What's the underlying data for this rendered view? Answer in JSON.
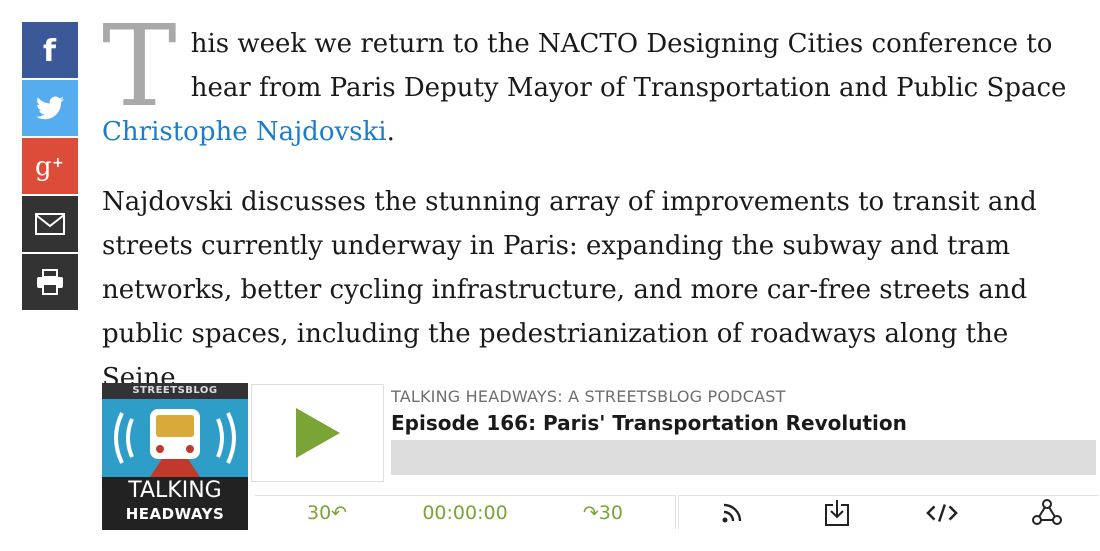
{
  "share": {
    "items": [
      {
        "name": "facebook",
        "icon": "facebook-icon",
        "color": "#3b5998"
      },
      {
        "name": "twitter",
        "icon": "twitter-icon",
        "color": "#55acee"
      },
      {
        "name": "google-plus",
        "icon": "google-plus-icon",
        "color": "#dd4b39"
      },
      {
        "name": "email",
        "icon": "mail-icon",
        "color": "#333333"
      },
      {
        "name": "print",
        "icon": "printer-icon",
        "color": "#333333"
      }
    ]
  },
  "article": {
    "dropcap": "T",
    "p1_text": "his week we return to the NACTO Designing Cities conference to hear from Paris Deputy Mayor of Transportation and Public Space ",
    "p1_link": "Christophe Najdovski",
    "p1_end": ".",
    "p2": "Najdovski discusses the stunning array of improvements to transit and streets currently underway in Paris: expanding the subway and tram networks, better cycling infrastructure, and more car-free streets and public spaces, including the pedestrianization of roadways along the Seine.",
    "link_color": "#1a7ccd"
  },
  "player": {
    "artwork": {
      "brand": "STREETSBLOG",
      "title_line1": "TALKING",
      "title_line2": "HEADWAYS"
    },
    "series": "TALKING HEADWAYS: A STREETSBLOG PODCAST",
    "episode": "Episode 166: Paris' Transportation Revolution",
    "progress": 0,
    "rewind": "30↶",
    "time": "00:00:00",
    "forward": "↷30",
    "accent": "#7aa536",
    "tools": [
      "rss-icon",
      "download-icon",
      "embed-code-icon",
      "share-icon"
    ]
  }
}
